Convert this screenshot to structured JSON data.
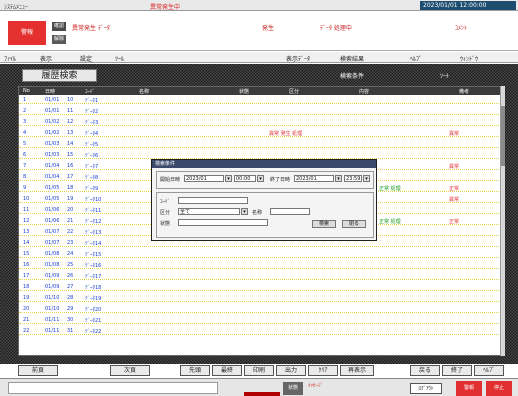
{
  "titlebar": {
    "app_title": "ｼｽﾃﾑﾒﾆｭｰ",
    "alert": "異常発生中",
    "right_info": "2023/01/01 12:00:00"
  },
  "header": {
    "alarm_button": "警報",
    "small_btn1": "確認",
    "small_btn2": "解除",
    "message1": "異常発生 ﾃﾞｰﾀ",
    "message2": "発生",
    "message3": "ﾃﾞｰﾀ 処理中",
    "message4": "ｺﾒﾝﾄ"
  },
  "toolbar": {
    "items": [
      "ﾌｧｲﾙ",
      "表示",
      "設定",
      "ﾂｰﾙ",
      "表示ﾃﾞｰﾀ",
      "検索結果",
      "ﾍﾙﾌﾟ",
      "ｳｨﾝﾄﾞｳ"
    ]
  },
  "page": {
    "title": "履歴検索",
    "filter1": "検索条件",
    "filter2": "ｿｰﾄ"
  },
  "table": {
    "headers": [
      "No",
      "日時",
      "ｺｰﾄﾞ",
      "名称",
      "状態",
      "区分",
      "内容",
      "備考"
    ],
    "rows": [
      {
        "no": "1",
        "a": "01/01",
        "b": "10",
        "c": "ﾃﾞｰﾀ1",
        "red": "",
        "green": "",
        "rt": ""
      },
      {
        "no": "2",
        "a": "01/01",
        "b": "11",
        "c": "ﾃﾞｰﾀ2",
        "red": "",
        "green": "",
        "rt": ""
      },
      {
        "no": "3",
        "a": "01/02",
        "b": "12",
        "c": "ﾃﾞｰﾀ3",
        "red": "",
        "green": "",
        "rt": ""
      },
      {
        "no": "4",
        "a": "01/02",
        "b": "13",
        "c": "ﾃﾞｰﾀ4",
        "red": "異常 発生 処理",
        "green": "",
        "rt": "異常"
      },
      {
        "no": "5",
        "a": "01/03",
        "b": "14",
        "c": "ﾃﾞｰﾀ5",
        "red": "",
        "green": "",
        "rt": ""
      },
      {
        "no": "6",
        "a": "01/03",
        "b": "15",
        "c": "ﾃﾞｰﾀ6",
        "red": "",
        "green": "",
        "rt": ""
      },
      {
        "no": "7",
        "a": "01/04",
        "b": "16",
        "c": "ﾃﾞｰﾀ7",
        "red": "",
        "green": "",
        "rt": "異常"
      },
      {
        "no": "8",
        "a": "01/04",
        "b": "17",
        "c": "ﾃﾞｰﾀ8",
        "red": "",
        "green": "",
        "rt": ""
      },
      {
        "no": "9",
        "a": "01/05",
        "b": "18",
        "c": "ﾃﾞｰﾀ9",
        "red": "",
        "green": "正常 処理",
        "rt": "正常"
      },
      {
        "no": "10",
        "a": "01/05",
        "b": "19",
        "c": "ﾃﾞｰﾀ10",
        "red": "",
        "green": "",
        "rt": "異常"
      },
      {
        "no": "11",
        "a": "01/06",
        "b": "20",
        "c": "ﾃﾞｰﾀ11",
        "red": "",
        "green": "",
        "rt": ""
      },
      {
        "no": "12",
        "a": "01/06",
        "b": "21",
        "c": "ﾃﾞｰﾀ12",
        "red": "",
        "green": "正常 処理",
        "rt": "正常"
      },
      {
        "no": "13",
        "a": "01/07",
        "b": "22",
        "c": "ﾃﾞｰﾀ13",
        "red": "",
        "green": "",
        "rt": ""
      },
      {
        "no": "14",
        "a": "01/07",
        "b": "23",
        "c": "ﾃﾞｰﾀ14",
        "red": "",
        "green": "",
        "rt": ""
      },
      {
        "no": "15",
        "a": "01/08",
        "b": "24",
        "c": "ﾃﾞｰﾀ15",
        "red": "",
        "green": "",
        "rt": ""
      },
      {
        "no": "16",
        "a": "01/08",
        "b": "25",
        "c": "ﾃﾞｰﾀ16",
        "red": "",
        "green": "",
        "rt": ""
      },
      {
        "no": "17",
        "a": "01/09",
        "b": "26",
        "c": "ﾃﾞｰﾀ17",
        "red": "",
        "green": "",
        "rt": ""
      },
      {
        "no": "18",
        "a": "01/09",
        "b": "27",
        "c": "ﾃﾞｰﾀ18",
        "red": "",
        "green": "",
        "rt": ""
      },
      {
        "no": "19",
        "a": "01/10",
        "b": "28",
        "c": "ﾃﾞｰﾀ19",
        "red": "",
        "green": "",
        "rt": ""
      },
      {
        "no": "20",
        "a": "01/10",
        "b": "29",
        "c": "ﾃﾞｰﾀ20",
        "red": "",
        "green": "",
        "rt": ""
      },
      {
        "no": "21",
        "a": "01/11",
        "b": "30",
        "c": "ﾃﾞｰﾀ21",
        "red": "",
        "green": "",
        "rt": ""
      },
      {
        "no": "22",
        "a": "01/11",
        "b": "31",
        "c": "ﾃﾞｰﾀ22",
        "red": "",
        "green": "",
        "rt": ""
      }
    ]
  },
  "dialog": {
    "title": "検索条件",
    "start_label": "開始日時",
    "start_value": "2023/01",
    "start_time": "00:00",
    "end_label": "終了日時",
    "end_value": "2023/01",
    "end_time": "23:59",
    "field1_label": "ｺｰﾄﾞ",
    "field1_value": "",
    "field2_label": "区分",
    "field2_value": "全て",
    "field3_label": "名称",
    "field3_value": "",
    "field4_label": "状態",
    "field4_value": "",
    "ok": "検索",
    "cancel": "閉る"
  },
  "bottom_buttons": [
    "前頁",
    "次頁",
    "先頭",
    "最終",
    "印刷",
    "出力",
    "ｸﾘｱ",
    "再表示",
    "戻る",
    "終了",
    "ﾍﾙﾌﾟ"
  ],
  "status": {
    "gray_label": "状態",
    "note": "ﾒｯｾｰｼﾞ",
    "btn": "ﾛｸﾞｱｳﾄ",
    "red1": "警報",
    "red2": "停止"
  },
  "colors": {
    "accent_red": "#e53030",
    "title_dark": "#1e4d6f",
    "link_blue": "#1a3fd0",
    "ok_green": "#1a9a1a"
  }
}
